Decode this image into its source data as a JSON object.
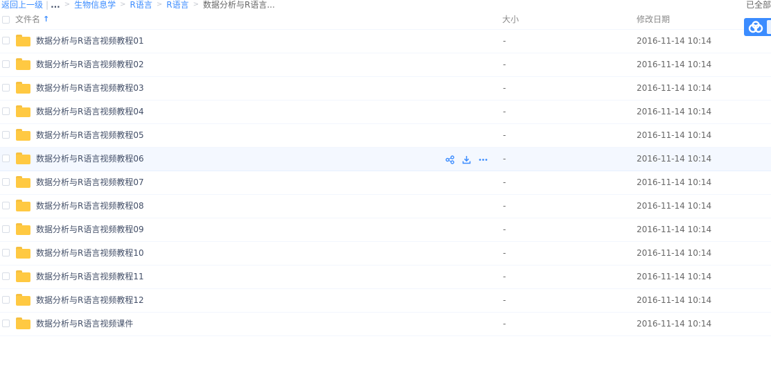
{
  "breadcrumb": {
    "back": "返回上一级",
    "ellipsis": "...",
    "items": [
      "生物信息学",
      "R语言",
      "R语言"
    ],
    "current": "数据分析与R语言..."
  },
  "loaded_text": "已全部",
  "header": {
    "name": "文件名",
    "sort_arrow": "↑",
    "size": "大小",
    "date": "修改日期"
  },
  "colors": {
    "accent": "#3b8cff",
    "folder": "#ffc942",
    "hover_row": "#f4f8ff"
  },
  "icons": {
    "badge": "cloud-logo-icon",
    "share": "share-icon",
    "download": "download-icon",
    "more": "more-icon",
    "folder": "folder-icon"
  },
  "files": [
    {
      "name": "数据分析与R语言视频教程01",
      "size": "-",
      "date": "2016-11-14 10:14"
    },
    {
      "name": "数据分析与R语言视频教程02",
      "size": "-",
      "date": "2016-11-14 10:14"
    },
    {
      "name": "数据分析与R语言视频教程03",
      "size": "-",
      "date": "2016-11-14 10:14"
    },
    {
      "name": "数据分析与R语言视频教程04",
      "size": "-",
      "date": "2016-11-14 10:14"
    },
    {
      "name": "数据分析与R语言视频教程05",
      "size": "-",
      "date": "2016-11-14 10:14"
    },
    {
      "name": "数据分析与R语言视频教程06",
      "size": "-",
      "date": "2016-11-14 10:14",
      "hover": true
    },
    {
      "name": "数据分析与R语言视频教程07",
      "size": "-",
      "date": "2016-11-14 10:14"
    },
    {
      "name": "数据分析与R语言视频教程08",
      "size": "-",
      "date": "2016-11-14 10:14"
    },
    {
      "name": "数据分析与R语言视频教程09",
      "size": "-",
      "date": "2016-11-14 10:14"
    },
    {
      "name": "数据分析与R语言视频教程10",
      "size": "-",
      "date": "2016-11-14 10:14"
    },
    {
      "name": "数据分析与R语言视频教程11",
      "size": "-",
      "date": "2016-11-14 10:14"
    },
    {
      "name": "数据分析与R语言视频教程12",
      "size": "-",
      "date": "2016-11-14 10:14"
    },
    {
      "name": "数据分析与R语言视频课件",
      "size": "-",
      "date": "2016-11-14 10:14"
    }
  ]
}
